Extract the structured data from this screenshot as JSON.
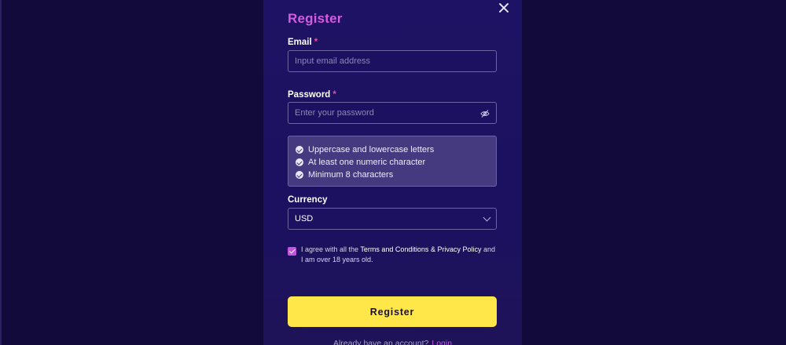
{
  "modal": {
    "title": "Register",
    "email": {
      "label": "Email",
      "required_mark": "*",
      "placeholder": "Input email address",
      "value": ""
    },
    "password": {
      "label": "Password",
      "required_mark": "*",
      "placeholder": "Enter your password",
      "value": "",
      "toggle_icon": "eye-off-icon"
    },
    "password_rules": [
      "Uppercase and lowercase letters",
      "At least one numeric character",
      "Minimum 8 characters"
    ],
    "currency": {
      "label": "Currency",
      "selected": "USD"
    },
    "agreement": {
      "checked": true,
      "prefix": "I agree with all the",
      "terms_link": "Terms and Conditions",
      "separator": "&",
      "privacy_link": "Privacy Policy",
      "suffix": "and I am over 18 years old."
    },
    "submit_label": "Register",
    "footer": {
      "prompt": "Already have an account?",
      "login_link": "Login"
    }
  },
  "colors": {
    "backdrop": "#120a3a",
    "modal_bg": "#1e1264",
    "title": "#d45ce0",
    "accent": "#c254e0",
    "required": "#e0529a",
    "button_bg": "#ffe74a",
    "rules_bg": "#453a80"
  }
}
